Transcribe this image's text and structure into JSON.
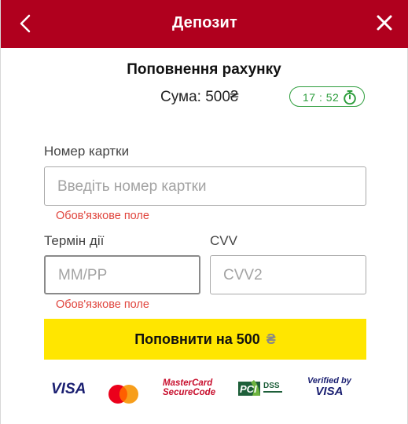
{
  "header": {
    "title": "Депозит",
    "back_icon": "chevron-left-icon",
    "close_icon": "close-icon",
    "bg_color": "#b0001e"
  },
  "summary": {
    "title": "Поповнення рахунку",
    "amount_label": "Сума: 500",
    "currency": "₴",
    "timer": "17 : 52",
    "timer_icon": "stopwatch-icon",
    "timer_color": "#2e9e3d"
  },
  "form": {
    "card_number": {
      "label": "Номер картки",
      "placeholder": "Введіть номер картки",
      "value": "",
      "error": "Обов'язкове поле"
    },
    "expiry": {
      "label": "Термін дії",
      "placeholder": "ММ/РР",
      "value": "",
      "error": "Обов'язкове поле"
    },
    "cvv": {
      "label": "CVV",
      "placeholder": "CVV2",
      "value": ""
    },
    "error_color": "#e0453d"
  },
  "submit": {
    "label": "Поповнити на 500",
    "currency": "₴",
    "bg_color": "#ffe600"
  },
  "payment_logos": {
    "visa": "VISA",
    "mastercard": "mastercard-logo",
    "securecode": [
      "MasterCard",
      "SecureCode"
    ],
    "pci": [
      "PCI",
      "DSS"
    ],
    "verified": [
      "Verified by",
      "VISA"
    ]
  }
}
